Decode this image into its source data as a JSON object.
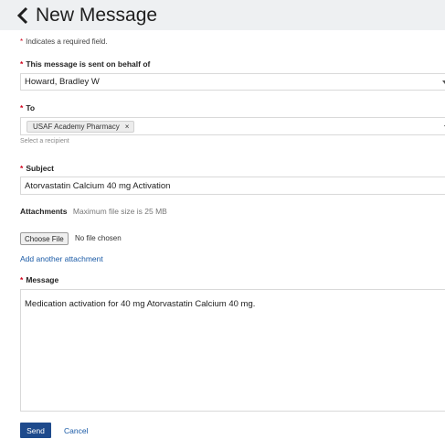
{
  "header": {
    "title": "New Message",
    "back_icon": "chevron-left-icon"
  },
  "form": {
    "required_note": "Indicates a required field.",
    "required_marker": "*",
    "on_behalf": {
      "label": "This message is sent on behalf of",
      "value": "Howard, Bradley W"
    },
    "to": {
      "label": "To",
      "chip": "USAF Academy Pharmacy",
      "chip_remove": "×",
      "helper": "Select a recipient"
    },
    "subject": {
      "label": "Subject",
      "value": "Atorvastatin Calcium 40 mg Activation"
    },
    "attachments": {
      "label": "Attachments",
      "note": "Maximum file size is 25 MB",
      "choose_button": "Choose File",
      "file_status": "No file chosen",
      "add_link": "Add another attachment"
    },
    "message": {
      "label": "Message",
      "value": "Medication activation for 40 mg Atorvastatin Calcium 40 mg."
    }
  },
  "actions": {
    "send": "Send",
    "cancel": "Cancel"
  },
  "colors": {
    "header_bg": "#eef0f2",
    "required": "#d0021b",
    "link": "#1a5aa6",
    "primary": "#1e4a8c"
  }
}
